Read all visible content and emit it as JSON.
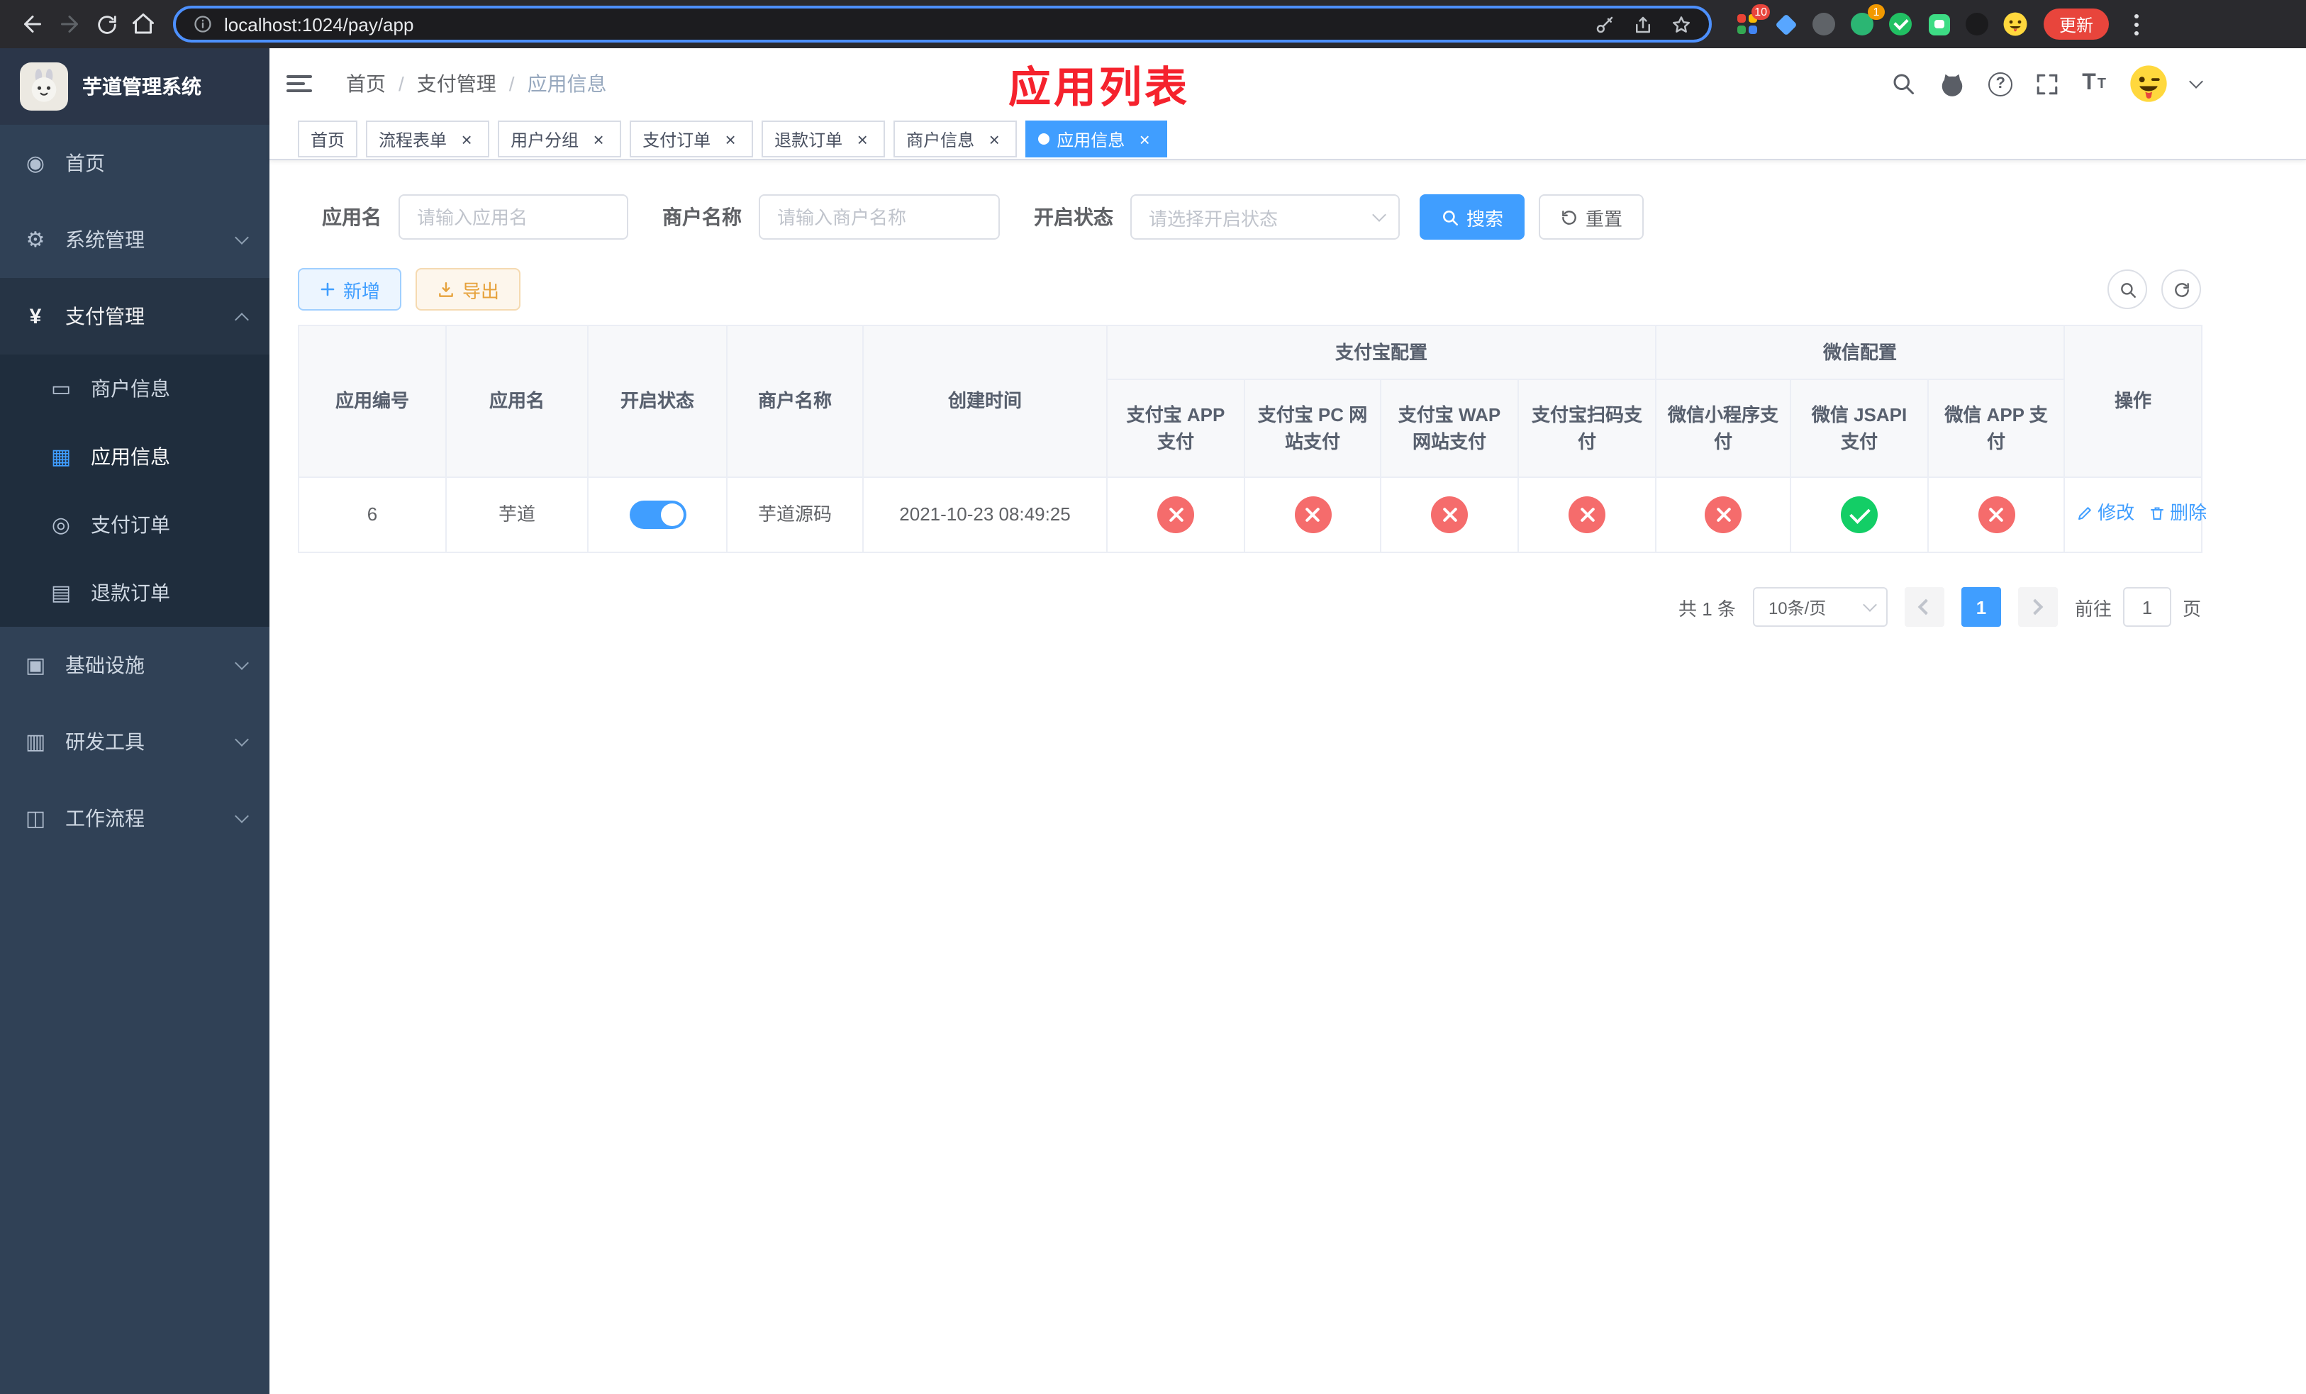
{
  "colors": {
    "primary": "#409eff",
    "danger_circle": "#f56c6c",
    "success_circle": "#13ce66",
    "title_red": "#f5222d",
    "sidebar_bg": "#304156",
    "submenu_bg": "#1f2d3d",
    "active_tag_bg": "#409eff",
    "update_button_bg": "#e8453c"
  },
  "browser": {
    "url": "localhost:1024/pay/app",
    "update_label": "更新",
    "extension_badge_tabs": "10",
    "extension_badge_avatar": "1"
  },
  "sidebar": {
    "app_title": "芋道管理系统",
    "items": [
      {
        "label": "首页",
        "glyph": "◉"
      },
      {
        "label": "系统管理",
        "glyph": "⚙"
      },
      {
        "label": "支付管理",
        "glyph": "¥"
      },
      {
        "label": "基础设施",
        "glyph": "▣"
      },
      {
        "label": "研发工具",
        "glyph": "▥"
      },
      {
        "label": "工作流程",
        "glyph": "◫"
      }
    ],
    "submenu": [
      {
        "label": "商户信息",
        "glyph": "▭"
      },
      {
        "label": "应用信息",
        "glyph": "▦"
      },
      {
        "label": "支付订单",
        "glyph": "◎"
      },
      {
        "label": "退款订单",
        "glyph": "▤"
      }
    ]
  },
  "navbar": {
    "breadcrumb": [
      "首页",
      "支付管理",
      "应用信息"
    ],
    "page_title": "应用列表"
  },
  "tags": [
    {
      "label": "首页"
    },
    {
      "label": "流程表单"
    },
    {
      "label": "用户分组"
    },
    {
      "label": "支付订单"
    },
    {
      "label": "退款订单"
    },
    {
      "label": "商户信息"
    },
    {
      "label": "应用信息"
    }
  ],
  "filters": {
    "app_name_label": "应用名",
    "app_name_placeholder": "请输入应用名",
    "merchant_label": "商户名称",
    "merchant_placeholder": "请输入商户名称",
    "status_label": "开启状态",
    "status_placeholder": "请选择开启状态",
    "search_label": "搜索",
    "reset_label": "重置"
  },
  "toolbar": {
    "add_label": "新增",
    "export_label": "导出"
  },
  "table": {
    "headers": {
      "app_id": "应用编号",
      "app_name": "应用名",
      "status": "开启状态",
      "merchant": "商户名称",
      "created": "创建时间",
      "alipay_group": "支付宝配置",
      "wechat_group": "微信配置",
      "alipay_cols": [
        "支付宝 APP 支付",
        "支付宝 PC 网站支付",
        "支付宝 WAP 网站支付",
        "支付宝扫码支付"
      ],
      "wechat_cols": [
        "微信小程序支付",
        "微信 JSAPI 支付",
        "微信 APP 支付"
      ],
      "actions": "操作"
    },
    "row": {
      "app_id": "6",
      "app_name": "芋道",
      "status": "on",
      "merchant": "芋道源码",
      "created": "2021-10-23 08:49:25",
      "configs": [
        "cross",
        "cross",
        "cross",
        "cross",
        "cross",
        "check",
        "cross"
      ],
      "edit_label": "修改",
      "delete_label": "删除"
    }
  },
  "pagination": {
    "total": "共 1 条",
    "page_size": "10条/页",
    "page": "1",
    "goto_label": "前往",
    "goto_value": "1",
    "unit_label": "页"
  },
  "icons": {
    "close": "×"
  }
}
